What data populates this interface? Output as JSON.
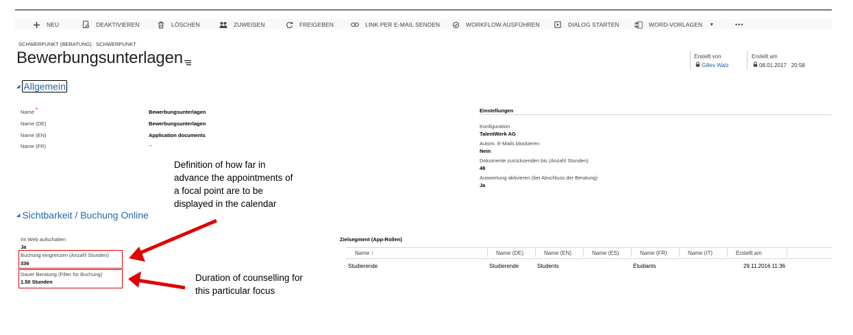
{
  "toolbar": {
    "items": [
      {
        "label": "NEU",
        "icon": "plus-icon"
      },
      {
        "label": "DEAKTIVIEREN",
        "icon": "deactivate-icon"
      },
      {
        "label": "LÖSCHEN",
        "icon": "trash-icon"
      },
      {
        "label": "ZUWEISEN",
        "icon": "assign-icon"
      },
      {
        "label": "FREIGEBEN",
        "icon": "share-icon"
      },
      {
        "label": "LINK PER E-MAIL SENDEN",
        "icon": "link-icon"
      },
      {
        "label": "WORKFLOW AUSFÜHREN",
        "icon": "workflow-icon"
      },
      {
        "label": "DIALOG STARTEN",
        "icon": "dialog-icon"
      },
      {
        "label": "WORD-VORLAGEN",
        "icon": "word-icon"
      }
    ],
    "more": "•••"
  },
  "header": {
    "breadcrumb": "SCHWERPUNKT (BERATUNG) : SCHWERPUNKT",
    "title": "Bewerbungsunterlagen",
    "created_by_label": "Erstellt von",
    "created_by_value": "Gilles Walz",
    "created_on_label": "Erstellt am",
    "created_on_value": "08.01.2017   20:58"
  },
  "allgemein": {
    "title": "Allgemein",
    "fields": [
      {
        "label": "Name",
        "value": "Bewerbungsunterlagen",
        "required": "*"
      },
      {
        "label": "Name (DE)",
        "value": "Bewerbungsunterlagen"
      },
      {
        "label": "Name (EN)",
        "value": "Application documents"
      },
      {
        "label": "Name (FR)",
        "value": "--"
      }
    ]
  },
  "einstellungen": {
    "title": "Einstellungen",
    "fields": [
      {
        "label": "Konfiguration",
        "value": "TalentWerk AG"
      },
      {
        "label": "Autom. E-Mails blockieren",
        "value": "Nein"
      },
      {
        "label": "Dokumente zurücksenden bis (Anzahl Stunden)",
        "value": "48"
      },
      {
        "label": "Auswertung aktivieren (bei Abschluss der Beratung)",
        "value": "Ja"
      }
    ]
  },
  "sichtbarkeit": {
    "title": "Sichtbarkeit / Buchung Online",
    "fields": [
      {
        "label": "Im Web aufschalten",
        "value": "Ja"
      },
      {
        "label": "Buchung eingrenzen (Anzahl Stunden)",
        "value": "336"
      },
      {
        "label": "Dauer Beratung (Filter für Buchung)",
        "value": "1.50 Stunden"
      }
    ]
  },
  "zielsegment": {
    "title": "Zielsegment (App-Rollen)",
    "columns": [
      "Name ↑",
      "Name (DE)",
      "Name (EN)",
      "Name (ES)",
      "Name (FR)",
      "Name (IT)",
      "Erstellt am"
    ],
    "rows": [
      [
        "Studierende",
        "Studierende",
        "Students",
        "",
        "Étudiants",
        "",
        "29.11.2016 11:36"
      ]
    ]
  },
  "annotations": {
    "calendar_note": [
      "Definition of how far in",
      "advance the appointments of",
      "a focal point are to be",
      "displayed in the calendar"
    ],
    "duration_note": [
      "Duration of counselling for",
      "this particular focus"
    ]
  },
  "colors": {
    "link": "#2266aa",
    "annotation_red": "#e00000",
    "toolbar_bg": "#f8f8f8"
  }
}
